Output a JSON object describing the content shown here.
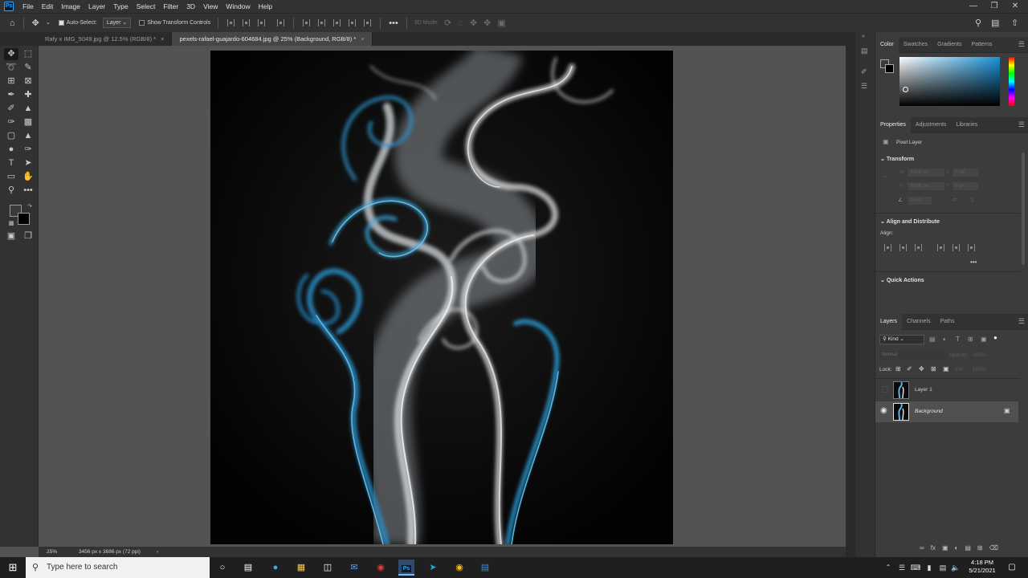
{
  "app": {
    "logo": "Ps"
  },
  "menu": [
    "File",
    "Edit",
    "Image",
    "Layer",
    "Type",
    "Select",
    "Filter",
    "3D",
    "View",
    "Window",
    "Help"
  ],
  "options_bar": {
    "auto_select_label": "Auto-Select:",
    "auto_select_checked": true,
    "layer_dropdown": "Layer",
    "show_transform_label": "Show Transform Controls",
    "show_transform_checked": false,
    "mode_3d_label": "3D Mode:",
    "more": "•••"
  },
  "tabs": [
    {
      "label": "Rafy x IMG_5049.jpg @ 12.5% (RGB/8) *",
      "active": false
    },
    {
      "label": "pexels-rafael-guajardo-604684.jpg @ 25% (Background, RGB/8) *",
      "active": true
    }
  ],
  "status": {
    "zoom": "25%",
    "doc_info": "3456 px x 3686 px (72 ppi)"
  },
  "color_panel": {
    "tabs": [
      "Color",
      "Swatches",
      "Gradients",
      "Patterns"
    ],
    "hue_color": "#1a93d8",
    "foreground": "#3a3a3a",
    "background": "#000000"
  },
  "properties_panel": {
    "tabs": [
      "Properties",
      "Adjustments",
      "Libraries"
    ],
    "kind": "Pixel Layer",
    "transform_title": "Transform",
    "w": "3456 px",
    "h": "3686 px",
    "x": "0 px",
    "y": "0 px",
    "angle": "0.00°",
    "align_title": "Align and Distribute",
    "align_label": "Align:",
    "quick_actions": "Quick Actions"
  },
  "layers_panel": {
    "tabs": [
      "Layers",
      "Channels",
      "Paths"
    ],
    "filter_kind": "Kind",
    "blend_mode": "Normal",
    "opacity_label": "Opacity:",
    "opacity_value": "100%",
    "lock_label": "Lock:",
    "fill_label": "Fill:",
    "fill_value": "100%",
    "layers": [
      {
        "name": "Layer 1",
        "visible": false,
        "locked": false,
        "selected": false
      },
      {
        "name": "Background",
        "visible": true,
        "locked": true,
        "selected": true
      }
    ]
  },
  "taskbar": {
    "search_placeholder": "Type here to search",
    "time": "4:18 PM",
    "date": "5/21/2021"
  }
}
